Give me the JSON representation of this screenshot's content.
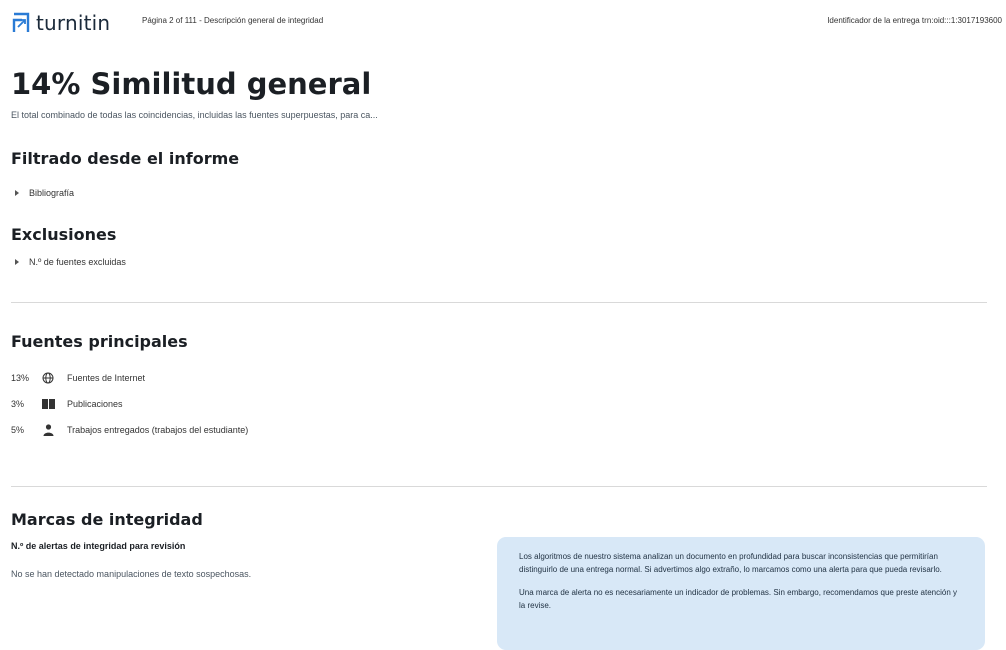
{
  "header": {
    "brand": "turnitin",
    "page_info": "Página 2 of 111 - Descripción general de integridad",
    "submission_id": "Identificador de la entrega trn:oid:::1:3017193600"
  },
  "overview": {
    "title": "14% Similitud general",
    "description": "El total combinado de todas las coincidencias, incluidas las fuentes superpuestas, para ca..."
  },
  "filtered": {
    "heading": "Filtrado desde el informe",
    "items": [
      "Bibliografía"
    ]
  },
  "exclusions": {
    "heading": "Exclusiones",
    "items": [
      "N.º de fuentes excluidas"
    ]
  },
  "sources": {
    "heading": "Fuentes principales",
    "rows": [
      {
        "pct": "13%",
        "icon": "globe-icon",
        "label": "Fuentes de Internet"
      },
      {
        "pct": "3%",
        "icon": "book-icon",
        "label": "Publicaciones"
      },
      {
        "pct": "5%",
        "icon": "person-icon",
        "label": "Trabajos entregados (trabajos del estudiante)"
      }
    ]
  },
  "integrity": {
    "heading": "Marcas de integridad",
    "subheading": "N.º de alertas de integridad para revisión",
    "none_text": "No se han detectado manipulaciones de texto sospechosas.",
    "info_p1": "Los algoritmos de nuestro sistema analizan un documento en profundidad para buscar inconsistencias que permitirían distinguirlo de una entrega normal. Si advertimos algo extraño, lo marcamos como una alerta para que pueda revisarlo.",
    "info_p2": "Una marca de alerta no es necesariamente un indicador de problemas. Sin embargo, recomendamos que preste atención y la revise."
  },
  "colors": {
    "brand_blue": "#2a7bd5",
    "info_box_bg": "#d8e8f7"
  }
}
